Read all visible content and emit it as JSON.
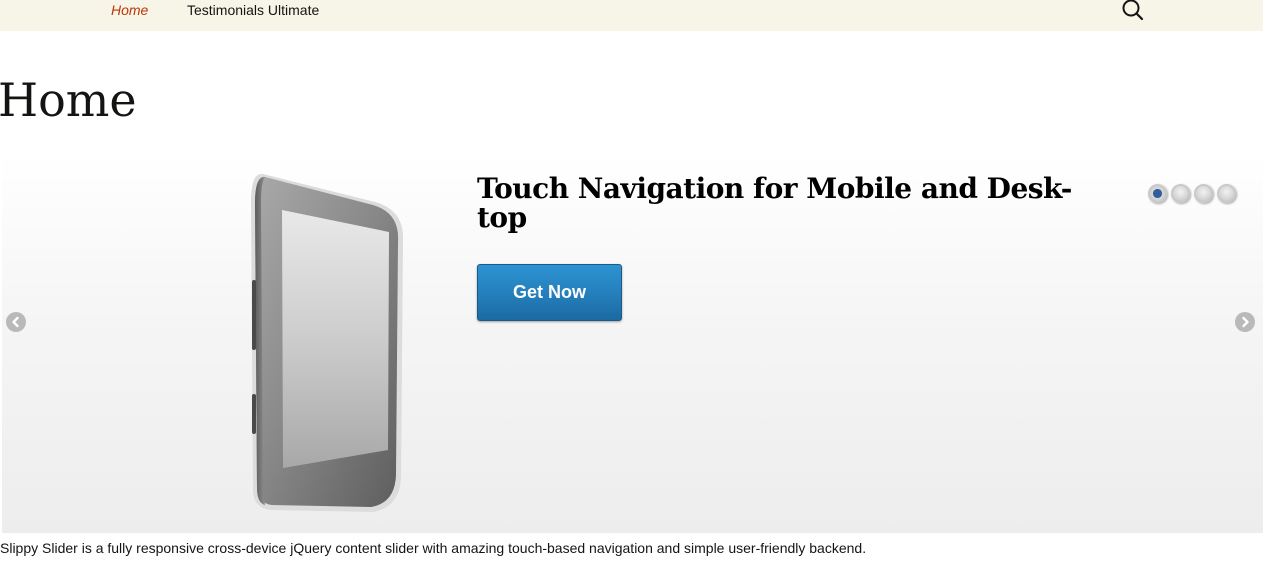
{
  "nav": {
    "items": [
      {
        "label": "Home",
        "active": true
      },
      {
        "label": "Testimonials Ultimate",
        "active": false
      }
    ],
    "search_icon": "search-icon"
  },
  "page": {
    "title": "Home"
  },
  "slider": {
    "slide_title": "Touch Navigation for Mobile and Desk-top",
    "button_label": "Get Now",
    "pagination": {
      "count": 4,
      "active_index": 0
    },
    "prev_icon": "chevron-left-icon",
    "next_icon": "chevron-right-icon",
    "image_icon": "tablet-device-image"
  },
  "caption": {
    "text": "Slippy Slider is a fully responsive cross-device jQuery content slider with amazing touch-based navigation and simple user-friendly backend."
  },
  "colors": {
    "nav_background": "#f7f5e7",
    "nav_active": "#bc360a",
    "button": "#2580bd",
    "active_dot": "#2d5f99"
  }
}
